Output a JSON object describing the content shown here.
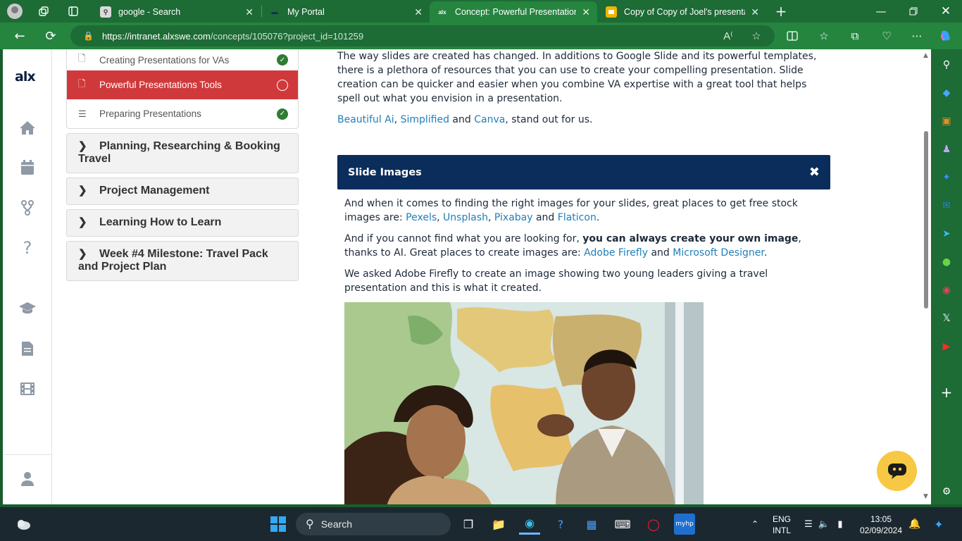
{
  "browser": {
    "tabs": [
      {
        "title": "google - Search"
      },
      {
        "title": "My Portal"
      },
      {
        "title": "Concept: Powerful Presentations"
      },
      {
        "title": "Copy of Copy of Joel's presentati"
      }
    ],
    "url_host": "https://intranet.alxswe.com",
    "url_path": "/concepts/105076?project_id=101259"
  },
  "brand": {
    "logo": "alx"
  },
  "sidebar": {
    "subitems": [
      {
        "label": "Creating Presentations for VAs"
      },
      {
        "label": "Powerful Presentations Tools"
      },
      {
        "label": "Preparing Presentations"
      }
    ],
    "sections": [
      {
        "label": "Planning, Researching & Booking Travel"
      },
      {
        "label": "Project Management"
      },
      {
        "label": "Learning How to Learn"
      },
      {
        "label": "Week #4 Milestone: Travel Pack and Project Plan"
      }
    ]
  },
  "content": {
    "intro": "The way slides are created has changed. In additions to Google Slide and its powerful templates, there is a plethora of resources that you can use to create your compelling presentation. Slide creation can be quicker and easier when you combine VA expertise with a great tool that helps spell out what you envision in a presentation.",
    "tools_line": {
      "t1": "Beautiful Ai",
      "sep1": ", ",
      "t2": "Simplified",
      "sep2": " and ",
      "t3": "Canva",
      "tail": ", stand out for us."
    },
    "banner_title": "Slide Images",
    "p1": {
      "pre": "And when it comes to finding the right images for your slides, great places to get free stock images are: ",
      "l1": "Pexels",
      "s1": ", ",
      "l2": "Unsplash",
      "s2": ", ",
      "l3": "Pixabay",
      "s3": " and ",
      "l4": "Flaticon",
      "end": "."
    },
    "p2": {
      "pre": "And if you cannot find what you are looking for, ",
      "bold": "you can always create your own image",
      "mid": ", thanks to AI. Great places to create images are: ",
      "l1": "Adobe Firefly",
      "s1": " and ",
      "l2": "Microsoft Designer",
      "end": "."
    },
    "p3": "We asked Adobe Firefly to create an image showing two young leaders giving a travel presentation and this is what it created."
  },
  "taskbar": {
    "search": "Search",
    "lang1": "ENG",
    "lang2": "INTL",
    "time": "13:05",
    "date": "02/09/2024"
  },
  "colors": {
    "accent_red": "#d0393b",
    "navy": "#0b2d5c",
    "link": "#1f7fb8",
    "done_green": "#2e7d32",
    "edge_green": "#1d6b35"
  }
}
